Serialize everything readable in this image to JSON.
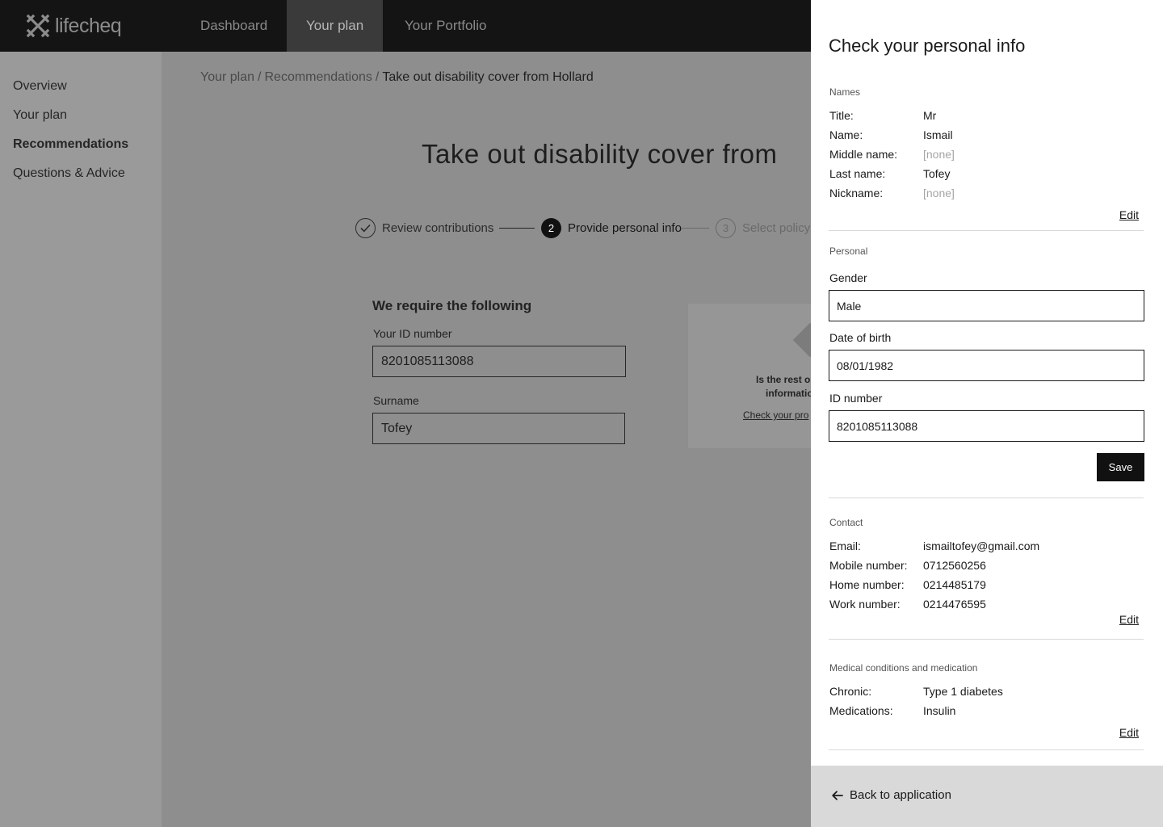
{
  "nav": {
    "logo_text": "lifecheq",
    "items": [
      {
        "label": "Dashboard",
        "active": false
      },
      {
        "label": "Your plan",
        "active": true
      },
      {
        "label": "Your Portfolio",
        "active": false
      }
    ]
  },
  "sidebar": {
    "items": [
      {
        "label": "Overview"
      },
      {
        "label": "Your plan"
      },
      {
        "label": "Recommendations",
        "active": true
      },
      {
        "label": "Questions & Advice"
      }
    ]
  },
  "main": {
    "breadcrumb": [
      "Your plan",
      "Recommendations",
      "Take out disability cover from Hollard"
    ],
    "breadcrumb_sep": "/",
    "title": "Take out disability cover from",
    "steps": [
      {
        "label": "Review contributions",
        "state": "done"
      },
      {
        "number": "2",
        "label": "Provide personal info",
        "state": "current"
      },
      {
        "number": "3",
        "label": "Select policy",
        "state": "pending"
      }
    ],
    "requirements_title": "We require the following",
    "fields": [
      {
        "label": "Your ID number",
        "value": "8201085113088"
      },
      {
        "label": "Surname",
        "value": "Tofey"
      }
    ],
    "info_card": {
      "line1": "Is the rest o",
      "line2": "informatio",
      "link": "Check your pro"
    }
  },
  "drawer": {
    "title": "Check your personal info",
    "names": {
      "section_title": "Names",
      "rows": [
        {
          "label": "Title:",
          "value": "Mr"
        },
        {
          "label": "Name:",
          "value": "Ismail"
        },
        {
          "label": "Middle name:",
          "value": "[none]",
          "muted": true
        },
        {
          "label": "Last name:",
          "value": "Tofey"
        },
        {
          "label": "Nickname:",
          "value": "[none]",
          "muted": true
        }
      ],
      "edit_label": "Edit"
    },
    "personal": {
      "section_title": "Personal",
      "gender_label": "Gender",
      "gender_value": "Male",
      "dob_label": "Date of birth",
      "dob_value": "08/01/1982",
      "id_label": "ID number",
      "id_value": "8201085113088",
      "save_label": "Save"
    },
    "contact": {
      "section_title": "Contact",
      "rows": [
        {
          "label": "Email:",
          "value": "ismailtofey@gmail.com"
        },
        {
          "label": "Mobile number:",
          "value": "0712560256"
        },
        {
          "label": "Home number:",
          "value": "0214485179"
        },
        {
          "label": "Work number:",
          "value": "0214476595"
        }
      ],
      "edit_label": "Edit"
    },
    "medical": {
      "section_title": "Medical conditions and medication",
      "rows": [
        {
          "label": "Chronic:",
          "value": "Type 1 diabetes"
        },
        {
          "label": "Medications:",
          "value": "Insulin"
        }
      ],
      "edit_label": "Edit"
    },
    "back_label": "Back to application"
  }
}
